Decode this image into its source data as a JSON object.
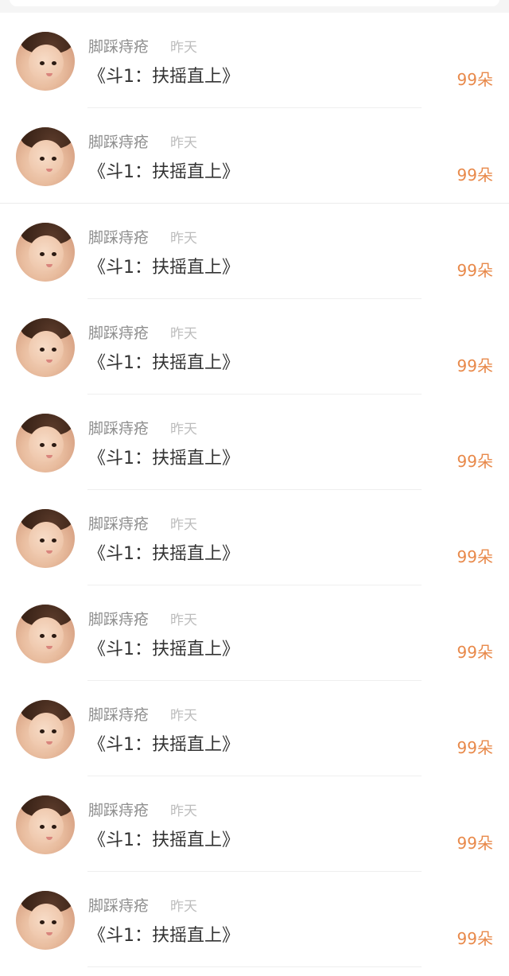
{
  "colors": {
    "count": "#e8894a",
    "name": "#8f8f8f",
    "time": "#bdbdbd",
    "title": "#333333"
  },
  "items": [
    {
      "user": "脚踩痔疮",
      "time": "昨天",
      "title": "《斗1：扶摇直上》",
      "count": "99朵"
    },
    {
      "user": "脚踩痔疮",
      "time": "昨天",
      "title": "《斗1：扶摇直上》",
      "count": "99朵"
    },
    {
      "user": "脚踩痔疮",
      "time": "昨天",
      "title": "《斗1：扶摇直上》",
      "count": "99朵"
    },
    {
      "user": "脚踩痔疮",
      "time": "昨天",
      "title": "《斗1：扶摇直上》",
      "count": "99朵"
    },
    {
      "user": "脚踩痔疮",
      "time": "昨天",
      "title": "《斗1：扶摇直上》",
      "count": "99朵"
    },
    {
      "user": "脚踩痔疮",
      "time": "昨天",
      "title": "《斗1：扶摇直上》",
      "count": "99朵"
    },
    {
      "user": "脚踩痔疮",
      "time": "昨天",
      "title": "《斗1：扶摇直上》",
      "count": "99朵"
    },
    {
      "user": "脚踩痔疮",
      "time": "昨天",
      "title": "《斗1：扶摇直上》",
      "count": "99朵"
    },
    {
      "user": "脚踩痔疮",
      "time": "昨天",
      "title": "《斗1：扶摇直上》",
      "count": "99朵"
    },
    {
      "user": "脚踩痔疮",
      "time": "昨天",
      "title": "《斗1：扶摇直上》",
      "count": "99朵"
    }
  ]
}
